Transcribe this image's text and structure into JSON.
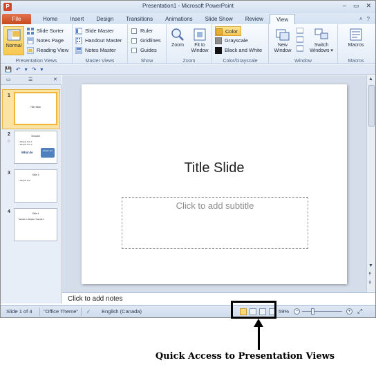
{
  "window": {
    "title": "Presentation1 - Microsoft PowerPoint",
    "app_icon_letter": "P",
    "controls": [
      "–",
      "▭",
      "✕"
    ]
  },
  "tabs": {
    "file": "File",
    "items": [
      "Home",
      "Insert",
      "Design",
      "Transitions",
      "Animations",
      "Slide Show",
      "Review",
      "View"
    ],
    "active": "View",
    "help_icons": [
      "˄",
      "?"
    ]
  },
  "ribbon": {
    "presentation_views": {
      "label": "Presentation Views",
      "normal": "Normal",
      "slide_sorter": "Slide Sorter",
      "notes_page": "Notes Page",
      "reading_view": "Reading View"
    },
    "master_views": {
      "label": "Master Views",
      "slide_master": "Slide Master",
      "handout_master": "Handout Master",
      "notes_master": "Notes Master"
    },
    "show": {
      "label": "Show",
      "ruler": "Ruler",
      "gridlines": "Gridlines",
      "guides": "Guides"
    },
    "zoom": {
      "label": "Zoom",
      "zoom": "Zoom",
      "fit_line1": "Fit to",
      "fit_line2": "Window"
    },
    "color": {
      "label": "Color/Grayscale",
      "color": "Color",
      "grayscale": "Grayscale",
      "bw": "Black and White"
    },
    "window": {
      "label": "Window",
      "new_line1": "New",
      "new_line2": "Window",
      "switch_line1": "Switch",
      "switch_line2": "Windows ▾"
    },
    "macros": {
      "label": "Macros",
      "macros": "Macros"
    }
  },
  "qat": [
    "💾",
    "↶",
    "▾",
    "↷",
    "▾"
  ],
  "panel": {
    "tab_slides": "▭",
    "tab_outline": "☰",
    "close": "✕",
    "thumbs": [
      {
        "num": "1",
        "title": "Title Slide"
      },
      {
        "num": "2",
        "head": "SmartArt",
        "bullets": [
          "• Sample Text 1",
          "• Sample Text 2"
        ],
        "what": "What do",
        "shape": "Sample Text"
      },
      {
        "num": "3",
        "head": "Slide 3",
        "bullets": [
          "• Sample Text"
        ]
      },
      {
        "num": "4",
        "head": "Slide 4",
        "bullets": [
          "Sample 1   Sample 2   Sample 3"
        ]
      }
    ]
  },
  "slide": {
    "title": "Title Slide",
    "subtitle_placeholder": "Click to add subtitle"
  },
  "scrollbar": {
    "up": "▲",
    "down": "▼",
    "prev": "⯭",
    "next": "⯯"
  },
  "notes": {
    "placeholder": "Click to add notes"
  },
  "status": {
    "slide_of": "Slide 1 of 4",
    "theme": "\"Office Theme\"",
    "spell_icon": "✓",
    "language": "English (Canada)",
    "zoom_level": "59%",
    "zoom_minus": "−",
    "zoom_plus": "+",
    "fit": "⤢"
  },
  "annotation": {
    "caption": "Quick Access to Presentation Views"
  },
  "colors": {
    "file_tab": "#d24726",
    "selected": "#f9c752",
    "ribbon_bg": "#e3ecf7"
  }
}
